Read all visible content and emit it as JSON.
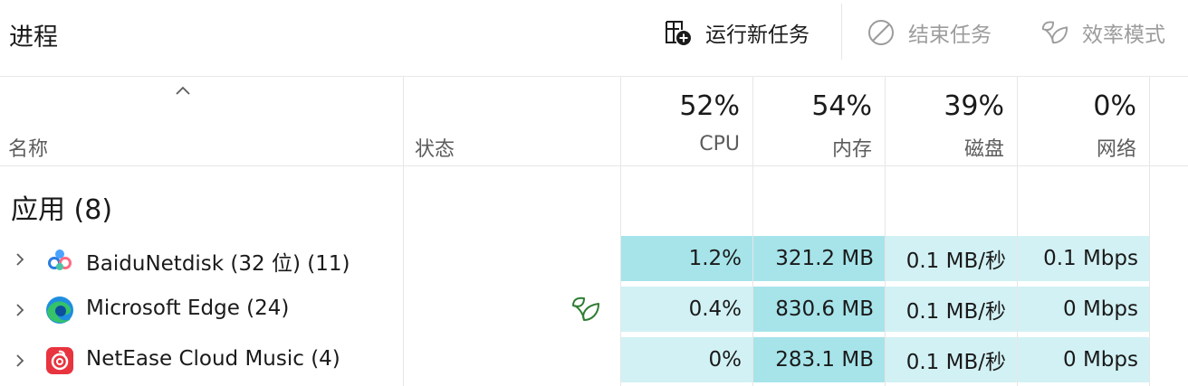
{
  "toolbar": {
    "title": "进程",
    "run_new_task": "运行新任务",
    "end_task": "结束任务",
    "efficiency_mode": "效率模式"
  },
  "columns": {
    "name": "名称",
    "status": "状态",
    "cpu": {
      "pct": "52%",
      "label": "CPU"
    },
    "memory": {
      "pct": "54%",
      "label": "内存"
    },
    "disk": {
      "pct": "39%",
      "label": "磁盘"
    },
    "network": {
      "pct": "0%",
      "label": "网络"
    }
  },
  "group": {
    "title": "应用 (8)"
  },
  "rows": [
    {
      "name": "BaiduNetdisk (32 位) (11)",
      "cpu": "1.2%",
      "memory": "321.2 MB",
      "disk": "0.1 MB/秒",
      "network": "0.1 Mbps",
      "icon": "baidu-netdisk-icon",
      "efficiency": false
    },
    {
      "name": "Microsoft Edge (24)",
      "cpu": "0.4%",
      "memory": "830.6 MB",
      "disk": "0.1 MB/秒",
      "network": "0 Mbps",
      "icon": "edge-icon",
      "efficiency": true
    },
    {
      "name": "NetEase Cloud Music (4)",
      "cpu": "0%",
      "memory": "283.1 MB",
      "disk": "0.1 MB/秒",
      "network": "0 Mbps",
      "icon": "netease-music-icon",
      "efficiency": false
    }
  ],
  "colors": {
    "heat_light": "#d2f1f4",
    "heat_medium": "#a6e4ea",
    "efficiency_green": "#2e7d32",
    "disabled_text": "#9c9c9c"
  }
}
